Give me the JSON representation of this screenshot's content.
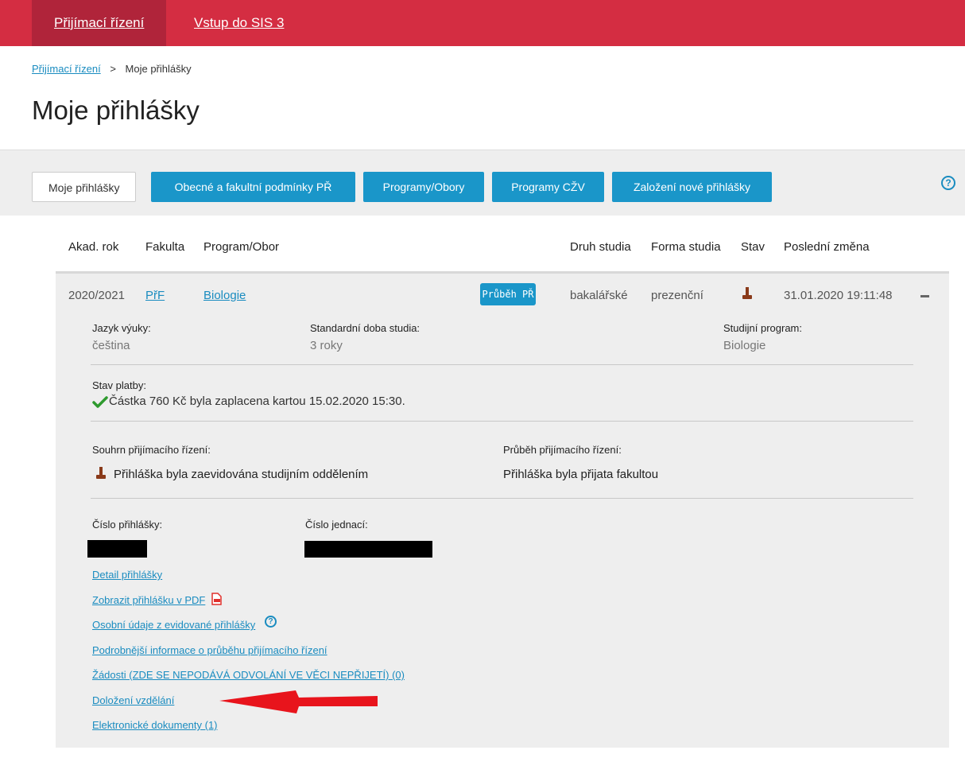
{
  "topnav": {
    "item1": "Přijímací řízení",
    "item2": "Vstup do SIS 3"
  },
  "breadcrumb": {
    "link": "Přijímací řízení",
    "sep": ">",
    "current": "Moje přihlášky"
  },
  "page_title": "Moje přihlášky",
  "tabs": [
    "Moje přihlášky",
    "Obecné a fakultní podmínky PŘ",
    "Programy/Obory",
    "Programy CŽV",
    "Založení nové přihlášky"
  ],
  "table": {
    "headers": [
      "Akad. rok",
      "Fakulta",
      "Program/Obor",
      "Druh studia",
      "Forma studia",
      "Stav",
      "Poslední změna"
    ],
    "row": {
      "year": "2020/2021",
      "faculty": "PřF",
      "program": "Biologie",
      "badge": "Průběh PŘ",
      "kind": "bakalářské",
      "form": "prezenční",
      "last_change": "31.01.2020 19:11:48"
    }
  },
  "details": {
    "lang_label": "Jazyk výuky:",
    "lang_value": "čeština",
    "duration_label": "Standardní doba studia:",
    "duration_value": "3 roky",
    "program_label": "Studijní program:",
    "program_value": "Biologie",
    "payment_label": "Stav platby:",
    "payment_value": "Částka 760 Kč byla zaplacena kartou 15.02.2020 15:30.",
    "summary_label": "Souhrn přijímacího řízení:",
    "summary_value": "Přihláška byla zaevidována studijním oddělením",
    "progress_label": "Průběh přijímacího řízení:",
    "progress_value": "Přihláška byla přijata fakultou",
    "appno_label": "Číslo přihlášky:",
    "refno_label": "Číslo jednací:"
  },
  "links": [
    "Detail přihlášky",
    "Zobrazit přihlášku v PDF",
    "Osobní údaje z evidované přihlášky",
    "Podrobnější informace o průběhu přijímacího řízení",
    "Žádosti (ZDE SE NEPODÁVÁ ODVOLÁNÍ VE VĚCI NEPŘIJETÍ) (0)",
    "Doložení vzdělání",
    "Elektronické dokumenty (1)"
  ],
  "icons": {
    "help": "?",
    "pdf": "pdf-icon",
    "stamp": "stamp-icon",
    "check": "check-icon",
    "arrow": "red-arrow"
  },
  "colors": {
    "brand": "#d42d42",
    "brand_dark": "#b0243a",
    "button": "#1a96c9",
    "link": "#1a8cc0",
    "check": "#2e9a2e",
    "stamp": "#8a3a1a",
    "arrow": "#e8141c"
  }
}
